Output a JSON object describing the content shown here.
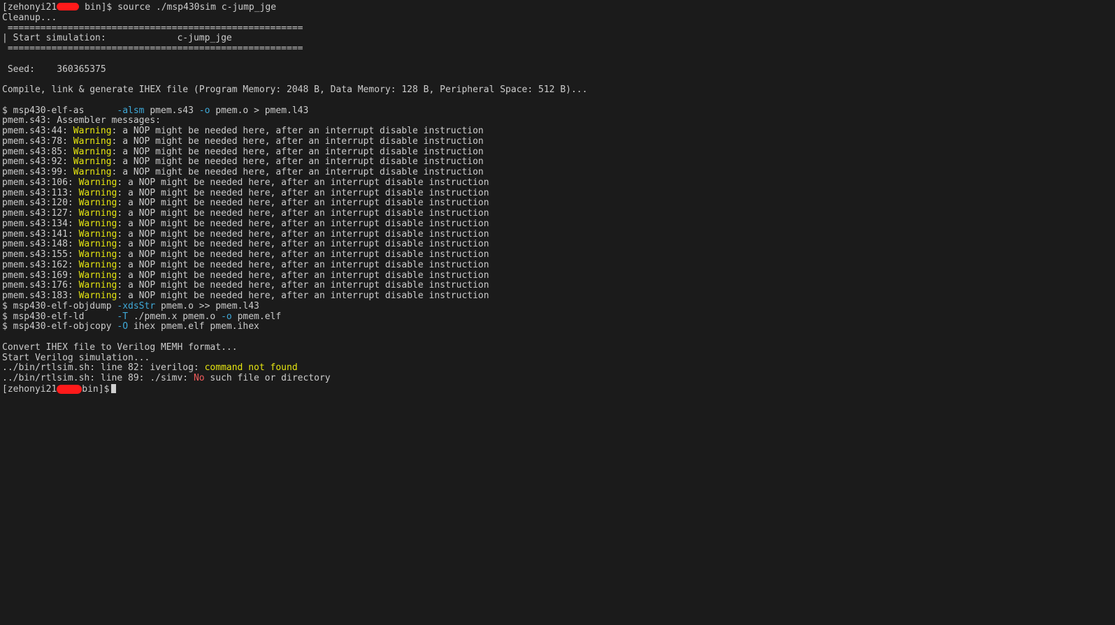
{
  "prompt1": {
    "user": "[zehonyi21",
    "dir": " bin]$ ",
    "command": "source ./msp430sim c-jump_jge"
  },
  "cleanup": "Cleanup...",
  "banner": {
    "rule": " ======================================================",
    "label": "| Start simulation:",
    "spacer": "             ",
    "test_name": "c-jump_jge"
  },
  "seed": {
    "label": " Seed:",
    "spacer": "    ",
    "value": "360365375"
  },
  "compile_msg": "Compile, link & generate IHEX file (Program Memory: 2048 B, Data Memory: 128 B, Peripheral Space: 512 B)...",
  "as_cmd": {
    "prompt": "$ msp430-elf-as      ",
    "flag1": "-alsm",
    "mid": " pmem.s43 ",
    "flag2": "-o",
    "tail": " pmem.o > pmem.l43"
  },
  "asm_header": "pmem.s43: Assembler messages:",
  "warning_word": "Warning",
  "warning_text": ": a NOP might be needed here, after an interrupt disable instruction",
  "warnings": [
    {
      "loc": "pmem.s43:44: "
    },
    {
      "loc": "pmem.s43:78: "
    },
    {
      "loc": "pmem.s43:85: "
    },
    {
      "loc": "pmem.s43:92: "
    },
    {
      "loc": "pmem.s43:99: "
    },
    {
      "loc": "pmem.s43:106: "
    },
    {
      "loc": "pmem.s43:113: "
    },
    {
      "loc": "pmem.s43:120: "
    },
    {
      "loc": "pmem.s43:127: "
    },
    {
      "loc": "pmem.s43:134: "
    },
    {
      "loc": "pmem.s43:141: "
    },
    {
      "loc": "pmem.s43:148: "
    },
    {
      "loc": "pmem.s43:155: "
    },
    {
      "loc": "pmem.s43:162: "
    },
    {
      "loc": "pmem.s43:169: "
    },
    {
      "loc": "pmem.s43:176: "
    },
    {
      "loc": "pmem.s43:183: "
    }
  ],
  "objdump_cmd": {
    "prompt": "$ msp430-elf-objdump ",
    "flag": "-xdsStr",
    "tail": " pmem.o >> pmem.l43"
  },
  "ld_cmd": {
    "prompt": "$ msp430-elf-ld      ",
    "flag1": "-T",
    "mid": " ./pmem.x pmem.o ",
    "flag2": "-o",
    "tail": " pmem.elf"
  },
  "objcopy_cmd": {
    "prompt": "$ msp430-elf-objcopy ",
    "flag": "-O",
    "tail": " ihex pmem.elf pmem.ihex"
  },
  "convert_msg": "Convert IHEX file to Verilog MEMH format...",
  "verilog_msg": "Start Verilog simulation...",
  "err1": {
    "prefix": "../bin/rtlsim.sh: line 82: iverilog: ",
    "msg": "command not found"
  },
  "err2": {
    "prefix": "../bin/rtlsim.sh: line 89: ./simv: ",
    "no": "No",
    "rest": " such file or directory"
  },
  "prompt2": {
    "user": "[zehonyi21",
    "dir": "bin]$"
  },
  "colors": {
    "background": "#1b1b1b",
    "text": "#cccccc",
    "warning": "#e5e510",
    "flag": "#3fa9d8",
    "error": "#ee5b5b",
    "redaction": "#ff1a1a"
  }
}
